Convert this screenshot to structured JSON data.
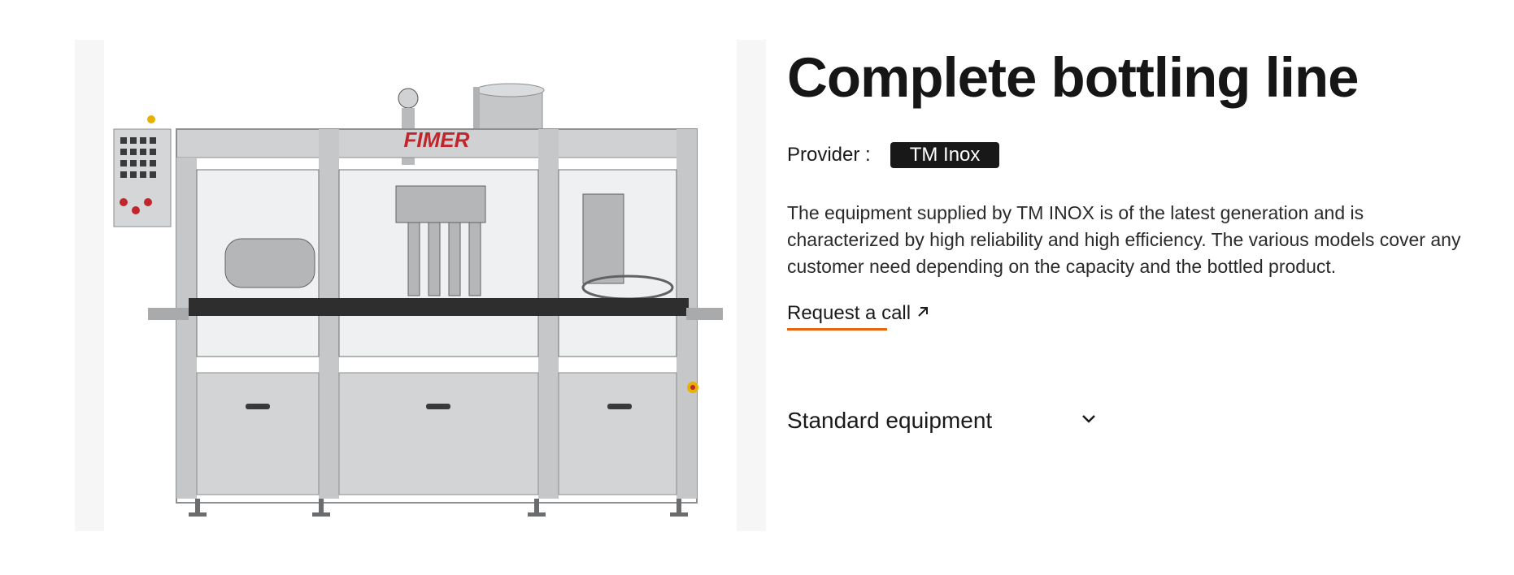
{
  "product": {
    "title": "Complete bottling line",
    "provider_label": "Provider :",
    "provider_name": "TM Inox",
    "description": "The equipment supplied by TM INOX is of the latest generation and is characterized by high reliability and high efficiency. The various models cover any customer need depending on the capacity and the bottled product.",
    "request_call_label": "Request a call",
    "image_alt": "Bottling machine",
    "machine_brand": "FIMER"
  },
  "accordion": {
    "standard_equipment_label": "Standard equipment"
  },
  "colors": {
    "accent": "#e8660f",
    "badge_bg": "#181818",
    "panel_bg": "#f5f5f5",
    "steel": "#c9cbcc",
    "brand_red": "#c0262c"
  },
  "icons": {
    "request_call": "arrow-up-right-icon",
    "accordion": "chevron-down-icon"
  }
}
